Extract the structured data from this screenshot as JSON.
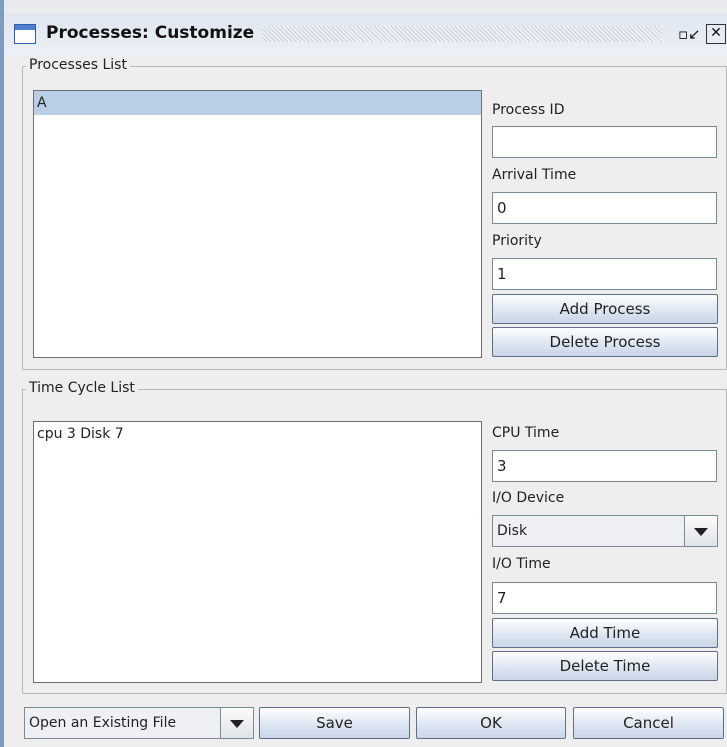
{
  "window": {
    "title": "Processes: Customize",
    "restore_icon": "restore-icon",
    "close_icon": "close-icon"
  },
  "processes": {
    "group_label": "Processes List",
    "items": [
      "A"
    ],
    "selected_index": 0,
    "process_id_label": "Process ID",
    "process_id_value": "",
    "arrival_time_label": "Arrival Time",
    "arrival_time_value": "0",
    "priority_label": "Priority",
    "priority_value": "1",
    "add_button": "Add Process",
    "delete_button": "Delete Process"
  },
  "time_cycle": {
    "group_label": "Time Cycle List",
    "items": [
      "cpu 3 Disk 7"
    ],
    "cpu_time_label": "CPU Time",
    "cpu_time_value": "3",
    "io_device_label": "I/O Device",
    "io_device_value": "Disk",
    "io_time_label": "I/O Time",
    "io_time_value": "7",
    "add_button": "Add Time",
    "delete_button": "Delete Time"
  },
  "footer": {
    "file_combo_value": "Open an Existing File",
    "save_button": "Save",
    "ok_button": "OK",
    "cancel_button": "Cancel"
  }
}
